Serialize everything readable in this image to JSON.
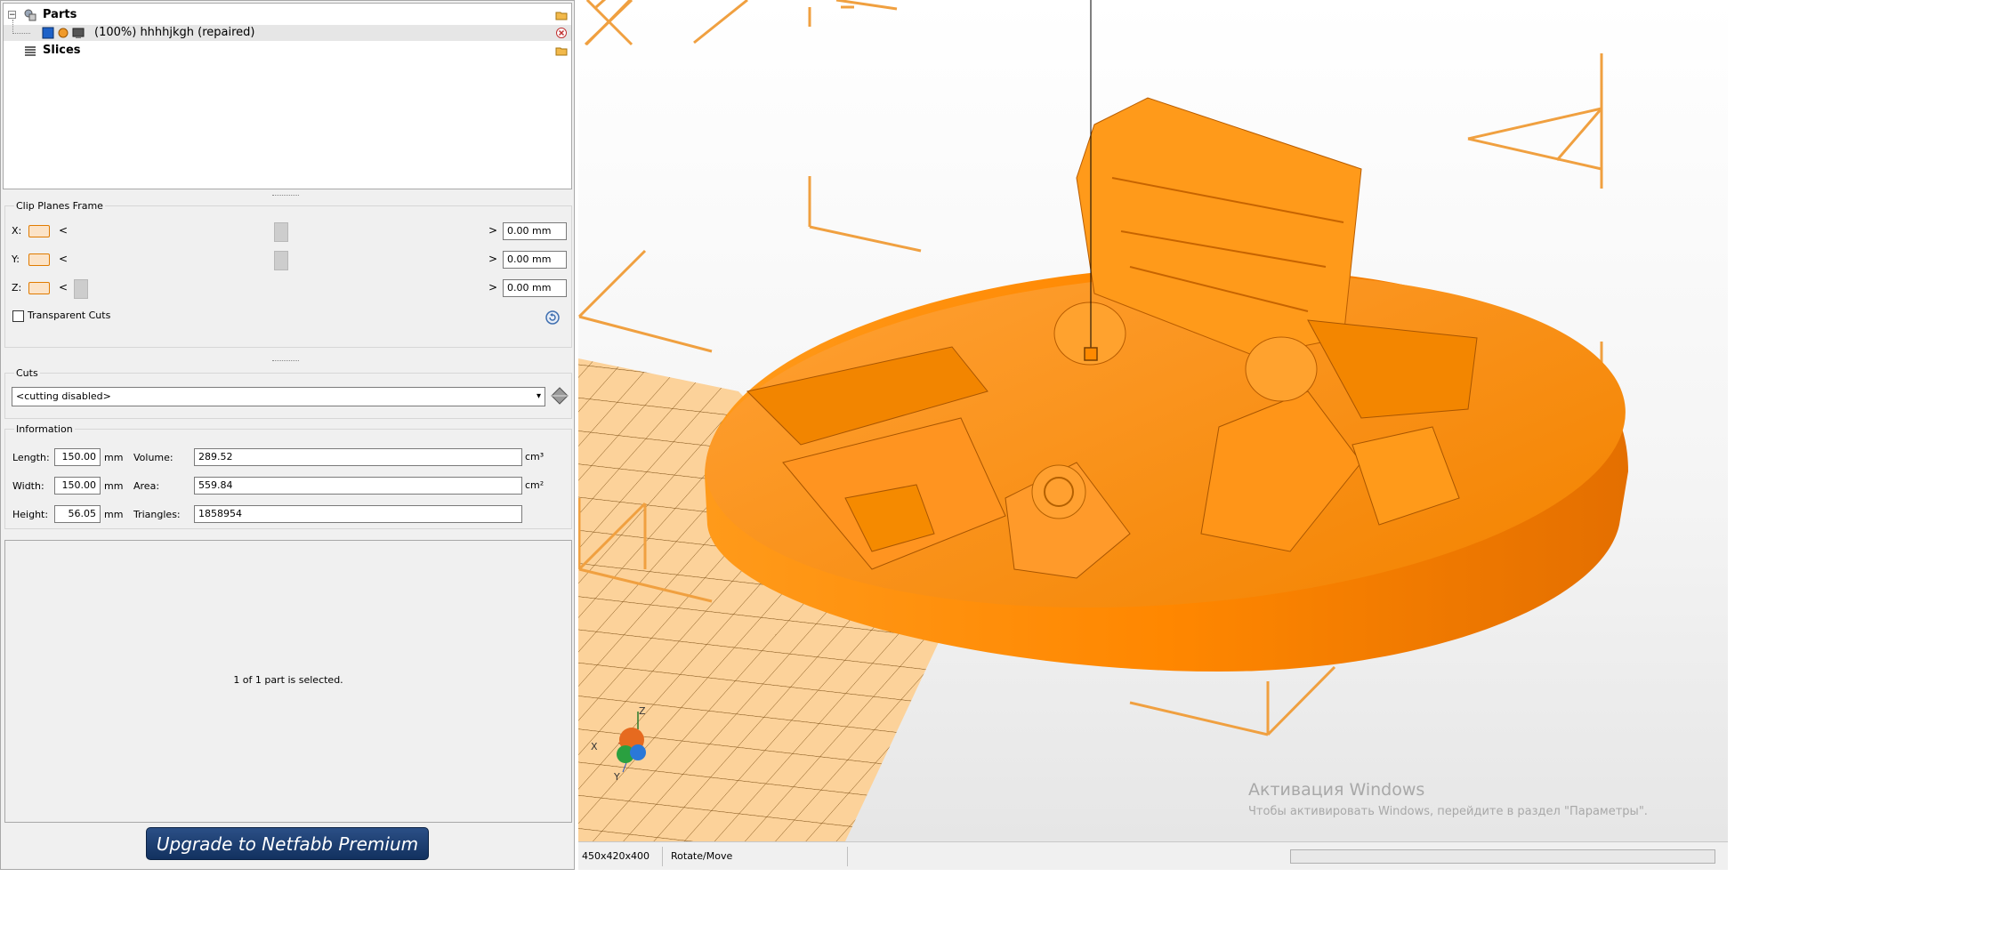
{
  "tree": {
    "parts_label": "Parts",
    "part_name": "(100%) hhhhjkgh (repaired)",
    "slices_label": "Slices"
  },
  "clip_planes": {
    "title": "Clip Planes Frame",
    "x_label": "X:",
    "y_label": "Y:",
    "z_label": "Z:",
    "x_value": "0.00 mm",
    "y_value": "0.00 mm",
    "z_value": "0.00 mm",
    "left_arrow": "<",
    "right_arrow": ">",
    "transparent_cuts_label": "Transparent Cuts",
    "transparent_cuts_checked": false
  },
  "cuts": {
    "title": "Cuts",
    "selected": "<cutting disabled>"
  },
  "information": {
    "title": "Information",
    "length_label": "Length:",
    "length_value": "150.00",
    "width_label": "Width:",
    "width_value": "150.00",
    "height_label": "Height:",
    "height_value": "56.05",
    "unit_mm": "mm",
    "volume_label": "Volume:",
    "volume_value": "289.52",
    "area_label": "Area:",
    "area_value": "559.84",
    "triangles_label": "Triangles:",
    "triangles_value": "1858954",
    "unit_cm3": "cm³",
    "unit_cm2": "cm²"
  },
  "selection_text": "1 of 1 part is selected.",
  "upgrade_button": "Upgrade to Netfabb Premium",
  "status": {
    "dimensions": "450x420x400",
    "mode": "Rotate/Move"
  },
  "watermark": {
    "line1": "Активация Windows",
    "line2": "Чтобы активировать Windows, перейдите в раздел \"Параметры\"."
  },
  "axes": {
    "x": "X",
    "y": "Y",
    "z": "Z"
  },
  "colors": {
    "model_orange": "#ff8c00",
    "frame_orange": "#f0a040",
    "plate_orange": "#fcd29a",
    "upgrade_blue": "#1d3f74"
  }
}
